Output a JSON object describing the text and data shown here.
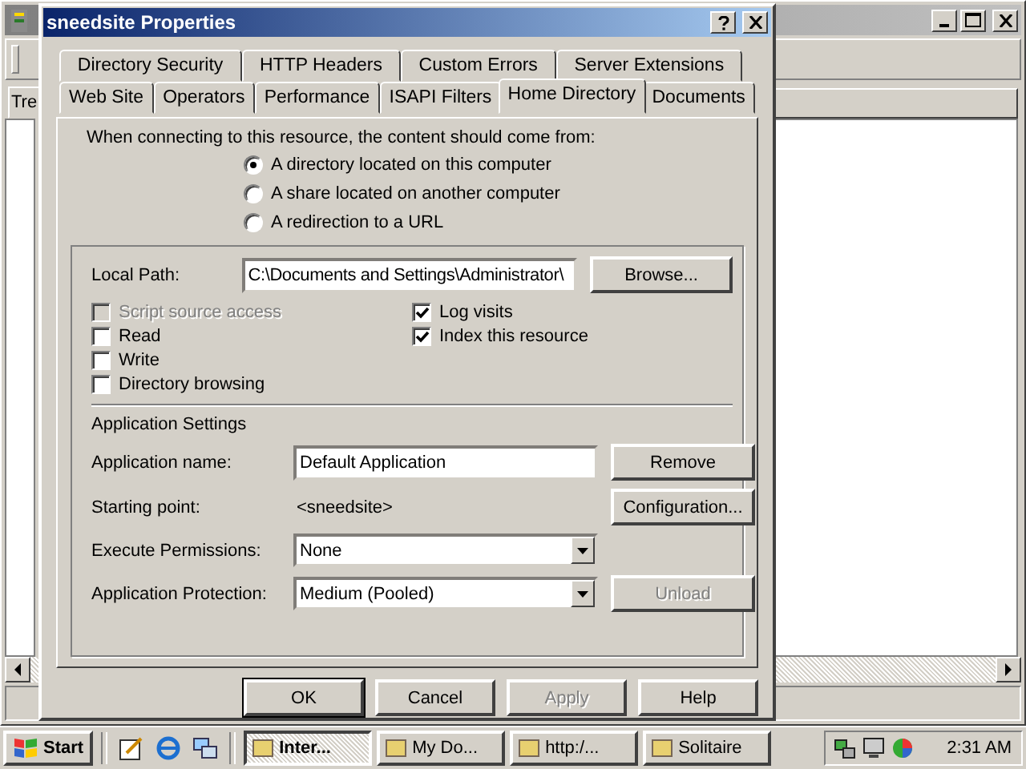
{
  "background_window": {
    "tree_tab": "Tre"
  },
  "dialog": {
    "title": "sneedsite Properties",
    "tabs_row1": [
      {
        "label": "Directory Security",
        "selected": false
      },
      {
        "label": "HTTP Headers",
        "selected": false
      },
      {
        "label": "Custom Errors",
        "selected": false
      },
      {
        "label": "Server Extensions",
        "selected": false
      }
    ],
    "tabs_row2": [
      {
        "label": "Web Site",
        "selected": false
      },
      {
        "label": "Operators",
        "selected": false
      },
      {
        "label": "Performance",
        "selected": false
      },
      {
        "label": "ISAPI Filters",
        "selected": false
      },
      {
        "label": "Home Directory",
        "selected": true
      },
      {
        "label": "Documents",
        "selected": false
      }
    ],
    "intro": "When connecting to this resource, the content should come from:",
    "content_source": [
      {
        "label": "A directory located on this computer",
        "selected": true
      },
      {
        "label": "A share located on another computer",
        "selected": false
      },
      {
        "label": "A redirection to a URL",
        "selected": false
      }
    ],
    "local_path": {
      "label": "Local Path:",
      "value": "C:\\Documents and Settings\\Administrator\\",
      "button": "Browse..."
    },
    "permissions_left": [
      {
        "label": "Script source access",
        "checked": false,
        "disabled": true
      },
      {
        "label": "Read",
        "checked": false,
        "disabled": false
      },
      {
        "label": "Write",
        "checked": false,
        "disabled": false
      },
      {
        "label": "Directory browsing",
        "checked": false,
        "disabled": false
      }
    ],
    "permissions_right": [
      {
        "label": "Log visits",
        "checked": true,
        "disabled": false
      },
      {
        "label": "Index this resource",
        "checked": true,
        "disabled": false
      }
    ],
    "app_settings_heading": "Application Settings",
    "app_name": {
      "label": "Application name:",
      "value": "Default Application"
    },
    "starting_point": {
      "label": "Starting point:",
      "value": "<sneedsite>"
    },
    "execute_permissions": {
      "label": "Execute Permissions:",
      "value": "None"
    },
    "app_protection": {
      "label": "Application Protection:",
      "value": "Medium (Pooled)"
    },
    "side_buttons": [
      {
        "label": "Remove",
        "disabled": false
      },
      {
        "label": "Configuration...",
        "disabled": false
      },
      {
        "label": "Unload",
        "disabled": true
      }
    ],
    "buttons": [
      {
        "label": "OK",
        "disabled": false,
        "default": true
      },
      {
        "label": "Cancel",
        "disabled": false,
        "default": false
      },
      {
        "label": "Apply",
        "disabled": true,
        "default": false
      },
      {
        "label": "Help",
        "disabled": false,
        "default": false
      }
    ]
  },
  "taskbar": {
    "start": "Start",
    "tasks": [
      {
        "label": "Inter...",
        "selected": true
      },
      {
        "label": "My Do...",
        "selected": false
      },
      {
        "label": "http:/...",
        "selected": false
      },
      {
        "label": "Solitaire",
        "selected": false
      }
    ],
    "clock": "2:31 AM"
  }
}
